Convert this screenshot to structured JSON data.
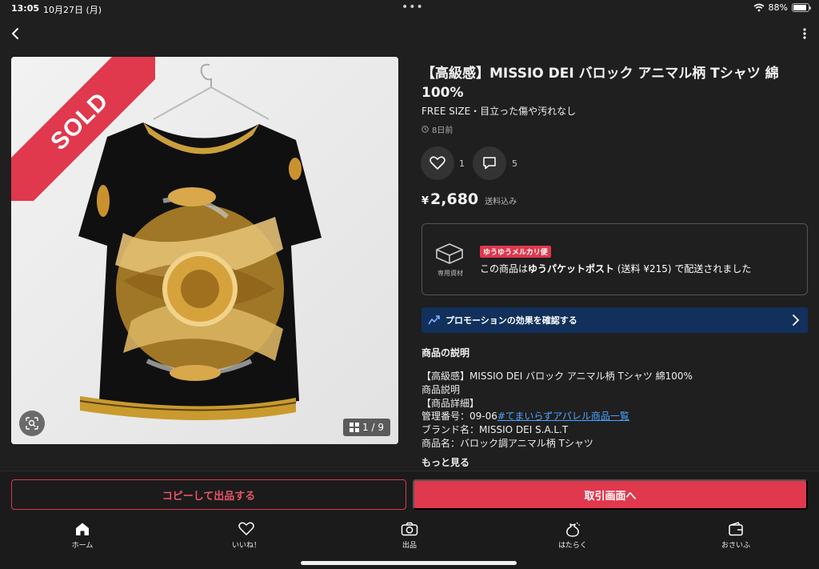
{
  "status_bar": {
    "time": "13:05",
    "date": "10月27日 (月)",
    "battery": "88%"
  },
  "product": {
    "title": "【高級感】MISSIO DEI バロック アニマル柄 Tシャツ 綿100%",
    "subtitle": "FREE SIZE・目立った傷や汚れなし",
    "posted": "8日前",
    "likes": "1",
    "comments": "5",
    "price_symbol": "¥",
    "price": "2,680",
    "shipping_included": "送料込み",
    "sold_label": "SOLD",
    "image_counter": "1 / 9"
  },
  "shipping": {
    "package_label": "専用資材",
    "badge": "ゆうゆうメルカリ便",
    "msg_pre": "この商品は",
    "method": "ゆうパケットポスト",
    "msg_post": "(送料 ¥215) で配送されました"
  },
  "promo": {
    "label": "プロモーションの効果を確認する"
  },
  "description": {
    "heading": "商品の説明",
    "line1": "【高級感】MISSIO DEI バロック アニマル柄 Tシャツ 綿100%",
    "line2": "商品説明",
    "line3": "【商品詳細】",
    "line4_prefix": "管理番号：09-06",
    "line4_link": "#てまいらずアパレル商品一覧",
    "line5": "ブランド名：MISSIO DEI S.A.L.T",
    "line6": "商品名：バロック調アニマル柄 Tシャツ",
    "see_more": "もっと見る"
  },
  "actions": {
    "copy_label": "コピーして出品する",
    "trade_label": "取引画面へ"
  },
  "tabs": [
    {
      "label": "ホーム",
      "icon": "home-icon"
    },
    {
      "label": "いいね！",
      "icon": "heart-icon"
    },
    {
      "label": "出品",
      "icon": "camera-icon"
    },
    {
      "label": "はたらく",
      "icon": "moneybag-icon"
    },
    {
      "label": "おさいふ",
      "icon": "wallet-icon"
    }
  ],
  "colors": {
    "accent": "#e0384d",
    "promo_bg": "#11305c",
    "link": "#4da3ff",
    "background": "#1f1f1f"
  }
}
